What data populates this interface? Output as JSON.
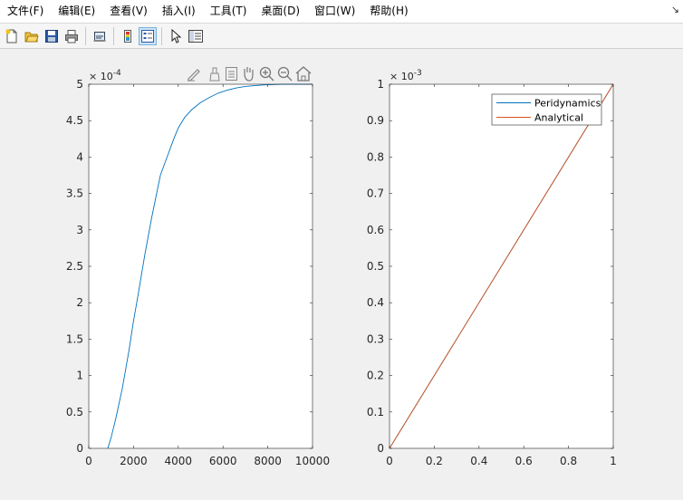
{
  "menu": {
    "items": [
      "文件(F)",
      "编辑(E)",
      "查看(V)",
      "插入(I)",
      "工具(T)",
      "桌面(D)",
      "窗口(W)",
      "帮助(H)"
    ],
    "overflow_arrow": "↘"
  },
  "toolbar": {
    "buttons": [
      "new-file-icon",
      "open-folder-icon",
      "save-icon",
      "print-icon",
      "link-plot-icon",
      "colorbar-icon",
      "legend-icon",
      "pointer-icon",
      "property-inspector-icon"
    ]
  },
  "axes_toolbar": {
    "buttons": [
      "edit-plot-icon",
      "brush-icon",
      "data-cursor-icon",
      "pan-icon",
      "zoom-in-icon",
      "zoom-out-icon",
      "home-icon"
    ]
  },
  "chart_data": [
    {
      "type": "line",
      "title": "",
      "xlabel": "",
      "ylabel": "",
      "xlim": [
        0,
        10000
      ],
      "ylim": [
        0,
        0.0005
      ],
      "y_exponent_label": "× 10",
      "y_exponent_power": "-4",
      "x_ticks": [
        "0",
        "2000",
        "4000",
        "6000",
        "8000",
        "10000"
      ],
      "y_ticks": [
        "0",
        "0.5",
        "1",
        "1.5",
        "2",
        "2.5",
        "3",
        "3.5",
        "4",
        "4.5",
        "5"
      ],
      "series": [
        {
          "color": "#0072bd",
          "x": [
            850,
            1000,
            1200,
            1500,
            1800,
            2000,
            2200,
            2500,
            2800,
            3000,
            3200,
            3500,
            3800,
            4000,
            4300,
            4600,
            5000,
            5400,
            5800,
            6200,
            6600,
            7000,
            7400,
            7800,
            8200,
            8600,
            9000,
            9500,
            10000
          ],
          "y": [
            0.0,
            1.5e-05,
            4e-05,
            8.25e-05,
            0.000135,
            0.000175,
            0.00021,
            0.000265,
            0.000315,
            0.000345,
            0.000375,
            0.0004,
            0.000425,
            0.00044,
            0.000455,
            0.000465,
            0.000475,
            0.000482,
            0.000488,
            0.000492,
            0.000495,
            0.000497,
            0.000498,
            0.000499,
            0.0004995,
            0.0005,
            0.0005,
            0.0005,
            0.0005
          ]
        }
      ]
    },
    {
      "type": "line",
      "title": "",
      "xlabel": "",
      "ylabel": "",
      "xlim": [
        0,
        1
      ],
      "ylim": [
        0,
        0.001
      ],
      "y_exponent_label": "× 10",
      "y_exponent_power": "-3",
      "x_ticks": [
        "0",
        "0.2",
        "0.4",
        "0.6",
        "0.8",
        "1"
      ],
      "y_ticks": [
        "0",
        "0.1",
        "0.2",
        "0.3",
        "0.4",
        "0.5",
        "0.6",
        "0.7",
        "0.8",
        "0.9",
        "1"
      ],
      "legend_position": "top-right",
      "series": [
        {
          "name": "Peridynamics",
          "color": "#0072bd",
          "x": [
            0,
            1
          ],
          "y": [
            0,
            0.001
          ]
        },
        {
          "name": "Analytical",
          "color": "#d95319",
          "x": [
            0,
            1
          ],
          "y": [
            0,
            0.001
          ]
        }
      ]
    }
  ]
}
